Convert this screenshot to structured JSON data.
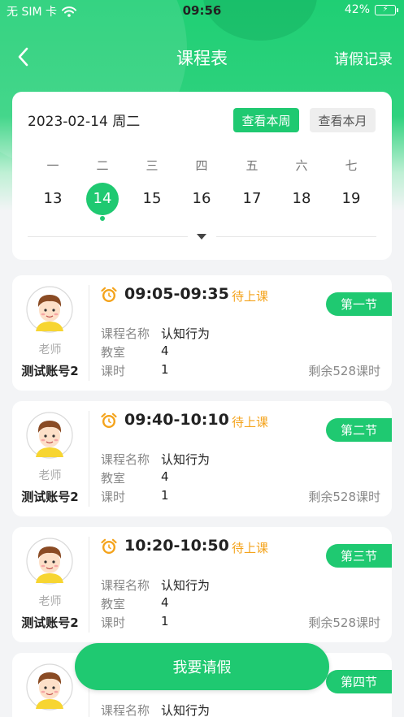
{
  "status_bar": {
    "carrier": "无 SIM 卡",
    "time": "09:56",
    "battery": "42%"
  },
  "nav": {
    "title": "课程表",
    "right_action": "请假记录"
  },
  "calendar": {
    "date_text": "2023-02-14  周二",
    "btn_week": "查看本周",
    "btn_month": "查看本月",
    "weekdays": [
      "一",
      "二",
      "三",
      "四",
      "五",
      "六",
      "七"
    ],
    "dates": [
      "13",
      "14",
      "15",
      "16",
      "17",
      "18",
      "19"
    ],
    "selected_index": 1
  },
  "lessons": [
    {
      "role": "老师",
      "teacher": "测试账号2",
      "time": "09:05-09:35",
      "status": "待上课",
      "period": "第一节",
      "course_label": "课程名称",
      "course": "认知行为",
      "room_label": "教室",
      "room": "4",
      "hours_label": "课时",
      "hours": "1",
      "remaining": "剩余528课时"
    },
    {
      "role": "老师",
      "teacher": "测试账号2",
      "time": "09:40-10:10",
      "status": "待上课",
      "period": "第二节",
      "course_label": "课程名称",
      "course": "认知行为",
      "room_label": "教室",
      "room": "4",
      "hours_label": "课时",
      "hours": "1",
      "remaining": "剩余528课时"
    },
    {
      "role": "老师",
      "teacher": "测试账号2",
      "time": "10:20-10:50",
      "status": "待上课",
      "period": "第三节",
      "course_label": "课程名称",
      "course": "认知行为",
      "room_label": "教室",
      "room": "4",
      "hours_label": "课时",
      "hours": "1",
      "remaining": "剩余528课时"
    },
    {
      "period": "第四节",
      "course_label": "课程名称",
      "course": "认知行为"
    }
  ],
  "fab_label": "我要请假",
  "colors": {
    "brand": "#1fc971",
    "pending": "#f4a31b"
  }
}
